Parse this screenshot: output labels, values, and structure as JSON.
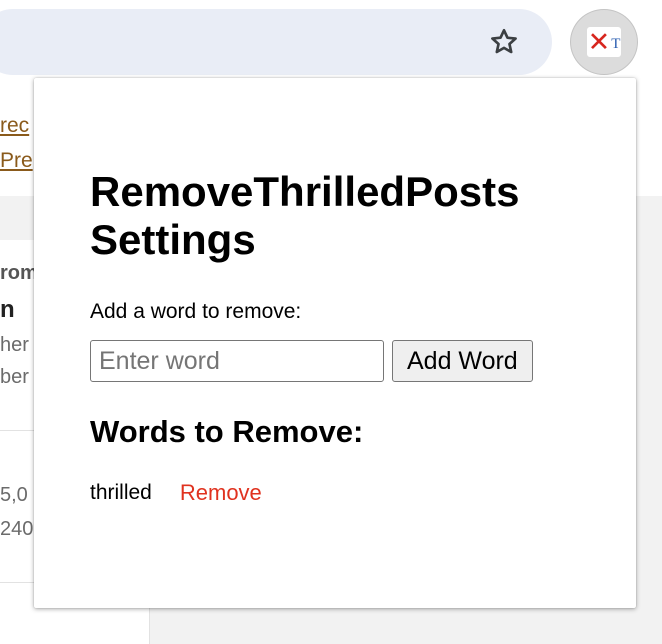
{
  "browser": {
    "bookmark_icon": "star-outline-icon",
    "extension_icon": "remove-thrilled-posts-icon",
    "extension_icon_glyph_x": "✕",
    "extension_icon_glyph_t": "T"
  },
  "background_page": {
    "link_1": "rec",
    "link_2": "Pre",
    "text_1": "rom",
    "text_2": "n",
    "text_3": "her",
    "text_4": "ber",
    "text_5": "5,0",
    "text_6": "240"
  },
  "popup": {
    "title": "RemoveThrilledPosts Settings",
    "add_label": "Add a word to remove:",
    "input_placeholder": "Enter word",
    "input_value": "",
    "add_button_label": "Add Word",
    "list_heading": "Words to Remove:",
    "words": [
      {
        "word": "thrilled",
        "remove_label": "Remove"
      }
    ]
  },
  "colors": {
    "remove_link": "#e0321f",
    "extension_x": "#d7261e",
    "omnibox_bg": "#e9edf6",
    "page_link": "#8a5a1b"
  }
}
